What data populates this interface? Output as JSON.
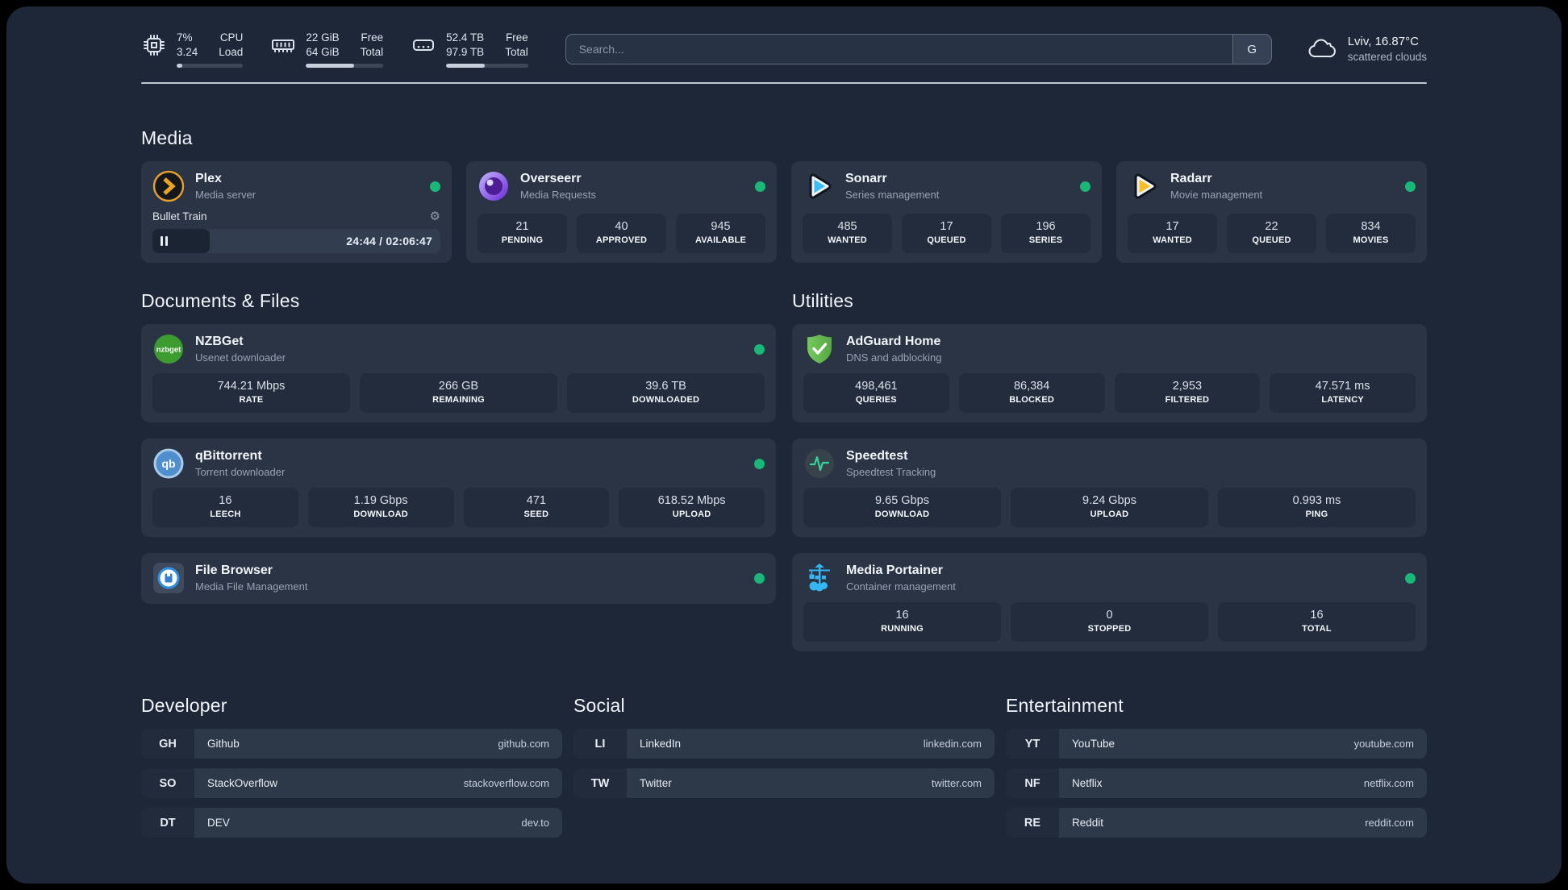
{
  "topbar": {
    "cpu": {
      "values": [
        "7%",
        "3.24"
      ],
      "labels": [
        "CPU",
        "Load"
      ],
      "progress_pct": 9
    },
    "memory": {
      "values": [
        "22 GiB",
        "64 GiB"
      ],
      "labels": [
        "Free",
        "Total"
      ],
      "progress_pct": 62
    },
    "disk": {
      "values": [
        "52.4 TB",
        "97.9 TB"
      ],
      "labels": [
        "Free",
        "Total"
      ],
      "progress_pct": 47
    },
    "search": {
      "placeholder": "Search...",
      "engine": "G"
    },
    "weather": {
      "summary": "Lviv, 16.87°C",
      "condition": "scattered clouds"
    }
  },
  "sections": {
    "media": "Media",
    "documents": "Documents & Files",
    "utilities": "Utilities",
    "developer": "Developer",
    "social": "Social",
    "entertainment": "Entertainment"
  },
  "apps": {
    "plex": {
      "name": "Plex",
      "subtitle": "Media server",
      "status": "online",
      "player": {
        "title": "Bullet Train",
        "time": "24:44 / 02:06:47",
        "progress_pct": 20,
        "state": "paused"
      }
    },
    "overseerr": {
      "name": "Overseerr",
      "subtitle": "Media Requests",
      "status": "online",
      "stats": [
        {
          "value": "21",
          "label": "PENDING"
        },
        {
          "value": "40",
          "label": "APPROVED"
        },
        {
          "value": "945",
          "label": "AVAILABLE"
        }
      ]
    },
    "sonarr": {
      "name": "Sonarr",
      "subtitle": "Series management",
      "status": "online",
      "stats": [
        {
          "value": "485",
          "label": "WANTED"
        },
        {
          "value": "17",
          "label": "QUEUED"
        },
        {
          "value": "196",
          "label": "SERIES"
        }
      ]
    },
    "radarr": {
      "name": "Radarr",
      "subtitle": "Movie management",
      "status": "online",
      "stats": [
        {
          "value": "17",
          "label": "WANTED"
        },
        {
          "value": "22",
          "label": "QUEUED"
        },
        {
          "value": "834",
          "label": "MOVIES"
        }
      ]
    },
    "nzbget": {
      "name": "NZBGet",
      "subtitle": "Usenet downloader",
      "status": "online",
      "stats": [
        {
          "value": "744.21 Mbps",
          "label": "RATE"
        },
        {
          "value": "266 GB",
          "label": "REMAINING"
        },
        {
          "value": "39.6 TB",
          "label": "DOWNLOADED"
        }
      ]
    },
    "qbittorrent": {
      "name": "qBittorrent",
      "subtitle": "Torrent downloader",
      "status": "online",
      "stats": [
        {
          "value": "16",
          "label": "LEECH"
        },
        {
          "value": "1.19 Gbps",
          "label": "DOWNLOAD"
        },
        {
          "value": "471",
          "label": "SEED"
        },
        {
          "value": "618.52 Mbps",
          "label": "UPLOAD"
        }
      ]
    },
    "filebrowser": {
      "name": "File Browser",
      "subtitle": "Media File Management",
      "status": "online"
    },
    "adguard": {
      "name": "AdGuard Home",
      "subtitle": "DNS and adblocking",
      "stats": [
        {
          "value": "498,461",
          "label": "QUERIES"
        },
        {
          "value": "86,384",
          "label": "BLOCKED"
        },
        {
          "value": "2,953",
          "label": "FILTERED"
        },
        {
          "value": "47.571 ms",
          "label": "LATENCY"
        }
      ]
    },
    "speedtest": {
      "name": "Speedtest",
      "subtitle": "Speedtest Tracking",
      "stats": [
        {
          "value": "9.65 Gbps",
          "label": "DOWNLOAD"
        },
        {
          "value": "9.24 Gbps",
          "label": "UPLOAD"
        },
        {
          "value": "0.993 ms",
          "label": "PING"
        }
      ]
    },
    "portainer": {
      "name": "Media Portainer",
      "subtitle": "Container management",
      "status": "online",
      "stats": [
        {
          "value": "16",
          "label": "RUNNING"
        },
        {
          "value": "0",
          "label": "STOPPED"
        },
        {
          "value": "16",
          "label": "TOTAL"
        }
      ]
    }
  },
  "links": {
    "developer": [
      {
        "tag": "GH",
        "name": "Github",
        "url": "github.com"
      },
      {
        "tag": "SO",
        "name": "StackOverflow",
        "url": "stackoverflow.com"
      },
      {
        "tag": "DT",
        "name": "DEV",
        "url": "dev.to"
      }
    ],
    "social": [
      {
        "tag": "LI",
        "name": "LinkedIn",
        "url": "linkedin.com"
      },
      {
        "tag": "TW",
        "name": "Twitter",
        "url": "twitter.com"
      }
    ],
    "entertainment": [
      {
        "tag": "YT",
        "name": "YouTube",
        "url": "youtube.com"
      },
      {
        "tag": "NF",
        "name": "Netflix",
        "url": "netflix.com"
      },
      {
        "tag": "RE",
        "name": "Reddit",
        "url": "reddit.com"
      }
    ]
  },
  "colors": {
    "status_online": "#18b877",
    "page_bg": "#1e2737",
    "card_bg": "#2a3444",
    "stat_bg": "#222c3c",
    "plex_orange": "#e9a02a",
    "sonarr_blue": "#38bdf8",
    "radarr_gold": "#fbbf24",
    "nzbget_green": "#3d9c30",
    "adguard_green": "#67bd51",
    "portainer_blue": "#35b6f2",
    "speedtest_pulse": "#34d399"
  }
}
